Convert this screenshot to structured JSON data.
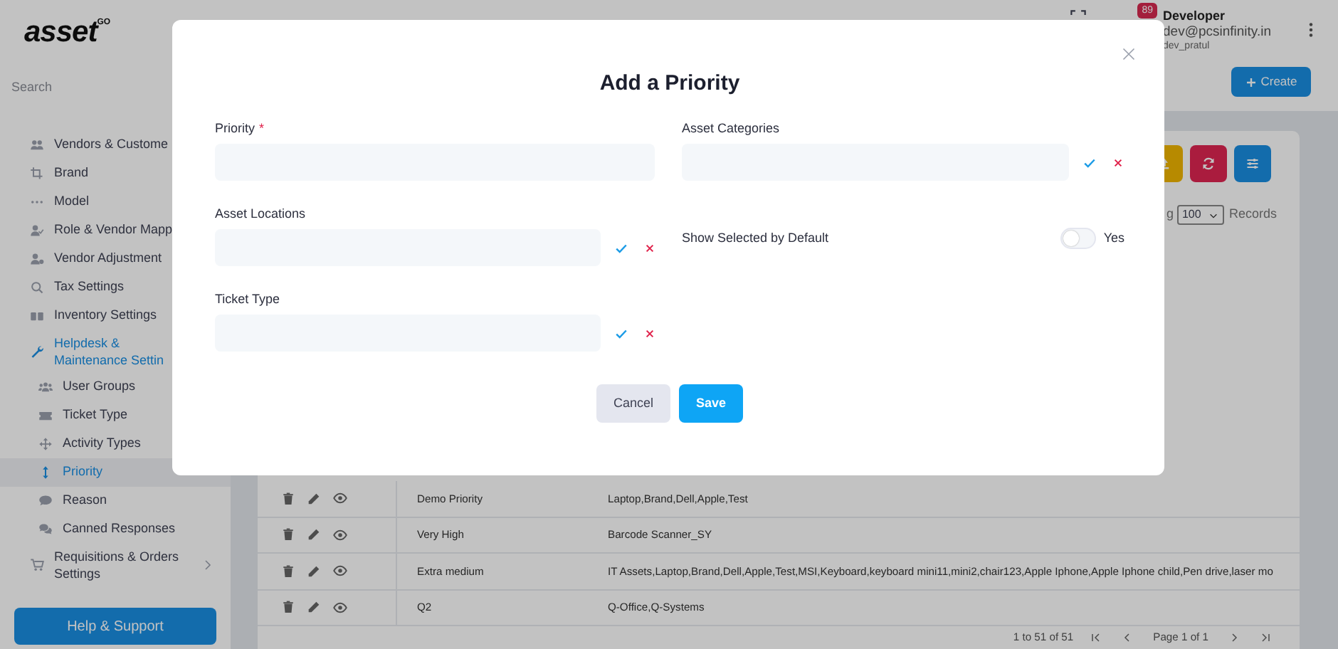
{
  "sidebar": {
    "logo": {
      "text": "asset",
      "sup": "GO"
    },
    "search": {
      "placeholder": "Search"
    },
    "items": [
      {
        "label": "Vendors & Custome",
        "kind": "link",
        "selected": false
      },
      {
        "label": "Brand",
        "kind": "link",
        "selected": false
      },
      {
        "label": "Model",
        "kind": "link",
        "selected": false
      },
      {
        "label": "Role & Vendor Mapp",
        "kind": "link",
        "selected": false
      },
      {
        "label": "Vendor Adjustment",
        "kind": "link",
        "selected": false
      },
      {
        "label": "Tax Settings",
        "kind": "link",
        "selected": false
      },
      {
        "label": "Inventory Settings",
        "kind": "link",
        "selected": false
      },
      {
        "label": "Helpdesk & Maintenance Settin",
        "kind": "group",
        "expanded": true,
        "selected": false,
        "children": [
          {
            "label": "User Groups",
            "selected": false
          },
          {
            "label": "Ticket Type",
            "selected": false
          },
          {
            "label": "Activity Types",
            "selected": false
          },
          {
            "label": "Priority",
            "selected": true
          },
          {
            "label": "Reason",
            "selected": false
          },
          {
            "label": "Canned Responses",
            "selected": false
          }
        ]
      },
      {
        "label": "Requisitions & Orders Settings",
        "kind": "group",
        "expanded": false,
        "selected": false
      }
    ],
    "help_button": "Help & Support"
  },
  "header": {
    "notifications": "89",
    "user_name": "Developer",
    "email": "dev@pcsinfinity.in",
    "username": "dev_pratul",
    "create_button": "Create"
  },
  "toolbar": {
    "showing_fragment": "g",
    "page_size": "100",
    "records_label": "Records"
  },
  "table": {
    "rows": [
      {
        "name": "Demo Priority",
        "categories": "Laptop,Brand,Dell,Apple,Test"
      },
      {
        "name": "Very High",
        "categories": "Barcode Scanner_SY"
      },
      {
        "name": "Extra medium",
        "categories": "IT Assets,Laptop,Brand,Dell,Apple,Test,MSI,Keyboard,keyboard mini11,mini2,chair123,Apple Iphone,Apple Iphone child,Pen drive,laser mo"
      },
      {
        "name": "Q2",
        "categories": "Q-Office,Q-Systems"
      }
    ],
    "footer": {
      "range": "1 to 51 of 51",
      "page": "Page 1 of 1"
    }
  },
  "modal": {
    "title": "Add a Priority",
    "fields": [
      {
        "label": "Priority",
        "kind": "text",
        "required_mark": "*"
      },
      {
        "label": "Asset Categories",
        "kind": "select"
      },
      {
        "label": "Asset Locations",
        "kind": "select"
      },
      {
        "label": "Show Selected by Default",
        "kind": "toggle",
        "on": false,
        "text": "Yes"
      },
      {
        "label": "Ticket Type",
        "kind": "select"
      }
    ],
    "buttons": [
      {
        "label": "Cancel",
        "kind": "secondary"
      },
      {
        "label": "Save",
        "kind": "primary"
      }
    ]
  }
}
